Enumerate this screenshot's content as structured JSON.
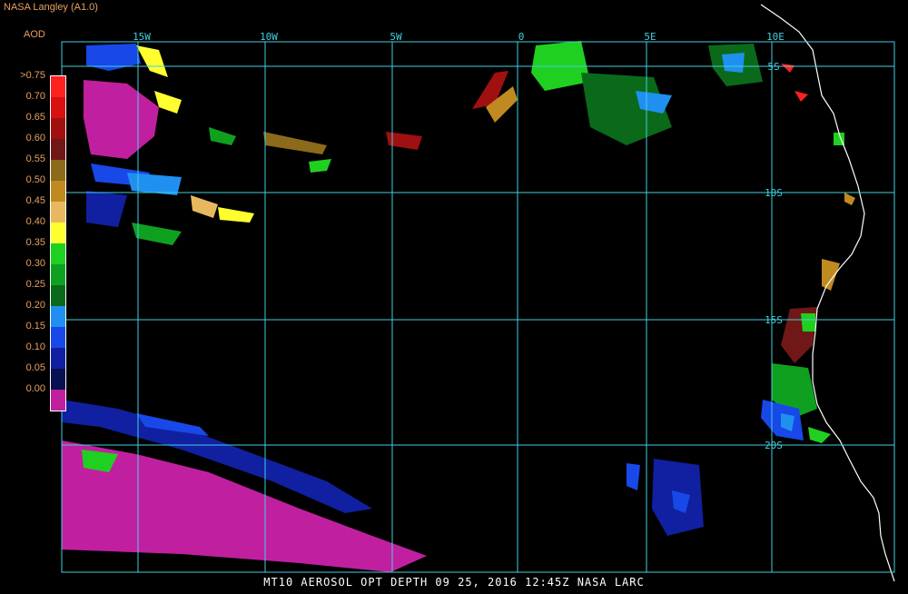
{
  "header": {
    "credit": "NASA Langley (A1.0)",
    "legend_title": "AOD"
  },
  "footer": {
    "caption": "MT10  AEROSOL OPT DEPTH   09 25, 2016 12:45Z   NASA LARC"
  },
  "legend": [
    {
      "label": ">0.75",
      "color": "#ff2020"
    },
    {
      "label": "0.70",
      "color": "#d81010"
    },
    {
      "label": "0.65",
      "color": "#a01010"
    },
    {
      "label": "0.60",
      "color": "#701818"
    },
    {
      "label": "0.55",
      "color": "#8b6a1a"
    },
    {
      "label": "0.50",
      "color": "#c08a20"
    },
    {
      "label": "0.45",
      "color": "#e8b860"
    },
    {
      "label": "0.40",
      "color": "#ffff30"
    },
    {
      "label": "0.35",
      "color": "#20d020"
    },
    {
      "label": "0.30",
      "color": "#10a020"
    },
    {
      "label": "0.25",
      "color": "#0a6a1a"
    },
    {
      "label": "0.20",
      "color": "#2090f0"
    },
    {
      "label": "0.15",
      "color": "#1848e8"
    },
    {
      "label": "0.10",
      "color": "#1020a0"
    },
    {
      "label": "0.05",
      "color": "#081050"
    },
    {
      "label": "0.00",
      "color": "#c020a0"
    }
  ],
  "grid": {
    "color": "#40d0e0",
    "lon_labels": [
      "15W",
      "10W",
      "5W",
      "0",
      "5E",
      "10E"
    ],
    "lat_labels": [
      "5S",
      "10S",
      "15S",
      "20S"
    ]
  },
  "coastline_color": "#ffffff"
}
